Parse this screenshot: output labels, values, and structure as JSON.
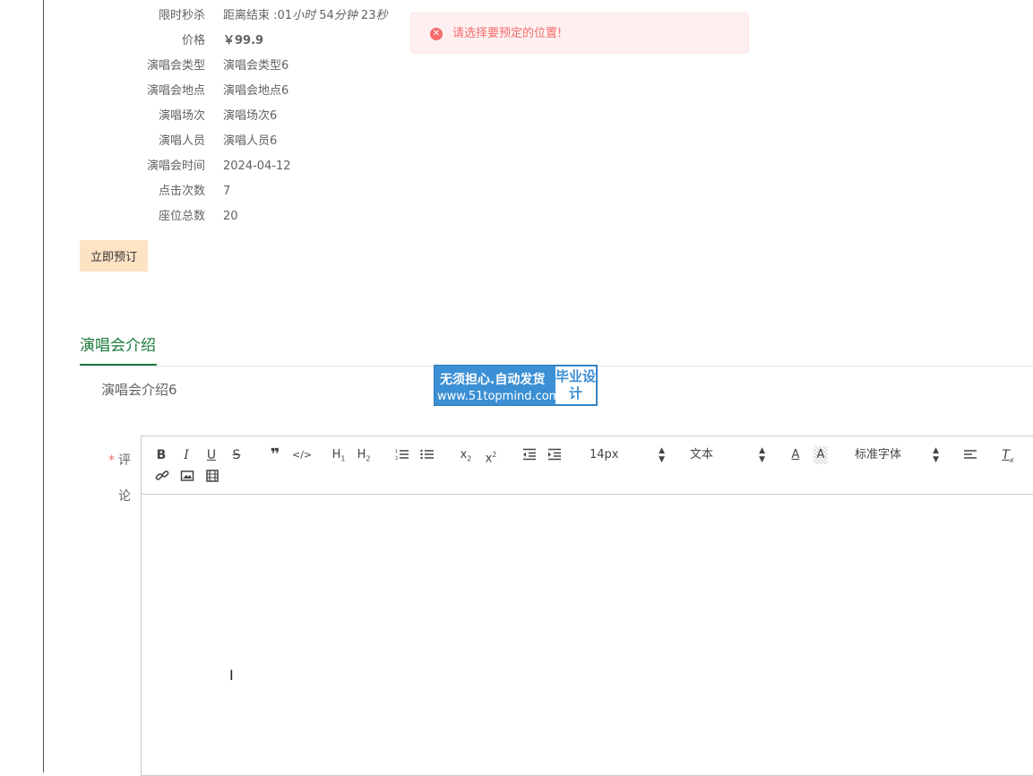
{
  "details": {
    "flash_sale_label": "限时秒杀",
    "countdown_prefix": "距离结束 :01",
    "countdown_hours": "小时",
    "countdown_min_value": "54",
    "countdown_min": "分钟",
    "countdown_sec_value": "23",
    "countdown_sec": "秒",
    "price_label": "价格",
    "price_value": "￥99.9",
    "type_label": "演唱会类型",
    "type_value": "演唱会类型6",
    "location_label": "演唱会地点",
    "location_value": "演唱会地点6",
    "session_label": "演唱场次",
    "session_value": "演唱场次6",
    "performers_label": "演唱人员",
    "performers_value": "演唱人员6",
    "time_label": "演唱会时间",
    "time_value": "2024-04-12",
    "clicks_label": "点击次数",
    "clicks_value": "7",
    "seats_label": "座位总数",
    "seats_value": "20"
  },
  "book_button": "立即预订",
  "alert": {
    "message": "请选择要预定的位置!",
    "icon": "error-circle-icon",
    "color": "#f56c6c"
  },
  "tabs": [
    {
      "label": "演唱会介绍",
      "active": true
    }
  ],
  "intro_text": "演唱会介绍6",
  "watermark": {
    "line1": "无须担心.自动发货",
    "line2": "www.51topmind.com",
    "right": "毕业设计"
  },
  "comment": {
    "required_mark": "*",
    "label_1": "评",
    "label_2": "论"
  },
  "editor": {
    "font_size": "14px",
    "header_type": "文本",
    "font_family": "标准字体",
    "tools": [
      "bold",
      "italic",
      "underline",
      "strike",
      "blockquote",
      "code-block",
      "h1",
      "h2",
      "ordered-list",
      "bullet-list",
      "subscript",
      "superscript",
      "outdent",
      "indent",
      "color",
      "background",
      "align",
      "clean",
      "link",
      "image",
      "video"
    ]
  },
  "colors": {
    "accent": "#1b7a3b",
    "book_button_bg": "#fde2c4",
    "alert_bg": "#fef0f0"
  }
}
